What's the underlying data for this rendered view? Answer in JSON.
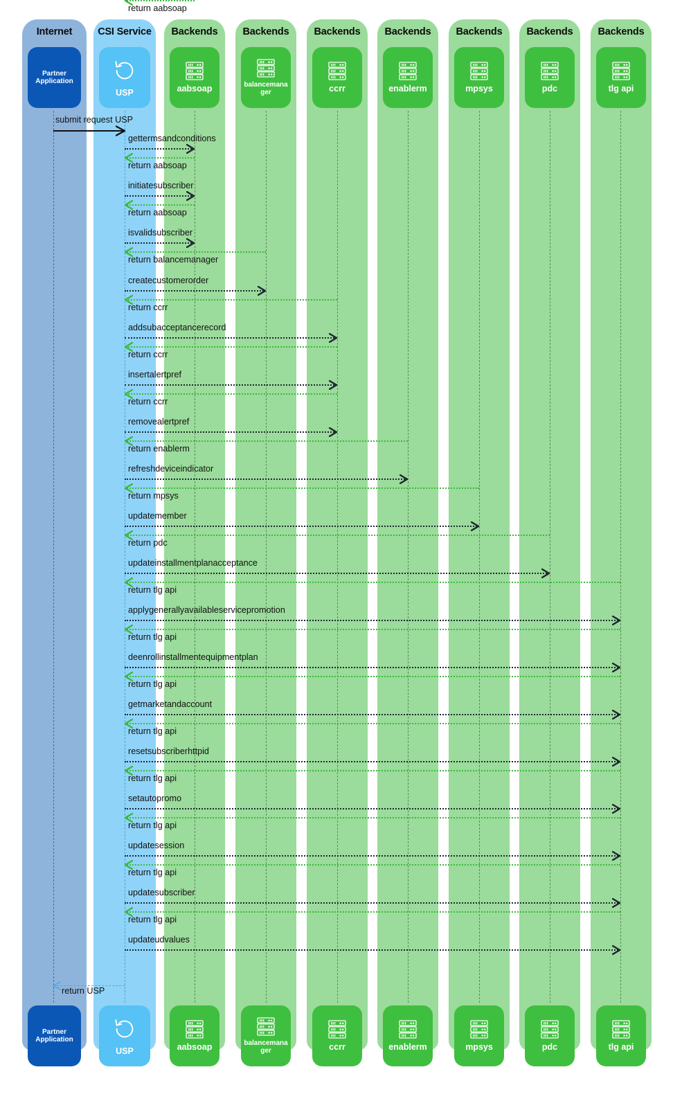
{
  "diagram": {
    "type": "sequence-diagram",
    "lanes": [
      {
        "id": "internet",
        "title": "Internet",
        "kind": "internet",
        "actor": "Partner Application",
        "icon": "none",
        "color": "#8FB4DC",
        "actor_color": "#0B57B5"
      },
      {
        "id": "csi",
        "title": "CSI Service",
        "kind": "csi",
        "actor": "USP",
        "icon": "refresh-icon",
        "color": "#90D3F8",
        "actor_color": "#56C2F5"
      },
      {
        "id": "aabsoap",
        "title": "Backends",
        "kind": "backend",
        "actor": "aabsoap",
        "icon": "server-icon",
        "color": "#9BDB9B",
        "actor_color": "#3FBF3F"
      },
      {
        "id": "balancemanager",
        "title": "Backends",
        "kind": "backend",
        "actor": "balancemanager",
        "icon": "server-icon",
        "color": "#9BDB9B",
        "actor_color": "#3FBF3F"
      },
      {
        "id": "ccrr",
        "title": "Backends",
        "kind": "backend",
        "actor": "ccrr",
        "icon": "server-icon",
        "color": "#9BDB9B",
        "actor_color": "#3FBF3F"
      },
      {
        "id": "enablerm",
        "title": "Backends",
        "kind": "backend",
        "actor": "enablerm",
        "icon": "server-icon",
        "color": "#9BDB9B",
        "actor_color": "#3FBF3F"
      },
      {
        "id": "mpsys",
        "title": "Backends",
        "kind": "backend",
        "actor": "mpsys",
        "icon": "server-icon",
        "color": "#9BDB9B",
        "actor_color": "#3FBF3F"
      },
      {
        "id": "pdc",
        "title": "Backends",
        "kind": "backend",
        "actor": "pdc",
        "icon": "server-icon",
        "color": "#9BDB9B",
        "actor_color": "#3FBF3F"
      },
      {
        "id": "tlgapi",
        "title": "Backends",
        "kind": "backend",
        "actor": "tlg api",
        "icon": "server-icon",
        "color": "#9BDB9B",
        "actor_color": "#3FBF3F"
      }
    ],
    "messages": [
      {
        "label": "submit request USP",
        "from": "internet",
        "to": "csi",
        "style": "solid-black",
        "dir": "right"
      },
      {
        "label": "gettermsandconditions",
        "from": "csi",
        "to": "aabsoap",
        "style": "dot-black",
        "dir": "right"
      },
      {
        "label": "return aabsoap",
        "from": "aabsoap",
        "to": "csi",
        "style": "dot-green",
        "dir": "left"
      },
      {
        "label": "initiatesubscriber",
        "from": "csi",
        "to": "aabsoap",
        "style": "dot-black",
        "dir": "right"
      },
      {
        "label": "return aabsoap",
        "from": "aabsoap",
        "to": "csi",
        "style": "dot-green",
        "dir": "left"
      },
      {
        "label": "isvalidsubscriber",
        "from": "csi",
        "to": "aabsoap",
        "style": "dot-black",
        "dir": "right"
      },
      {
        "label": "return aabsoap",
        "from": "aabsoap",
        "to": "csi",
        "style": "dot-green",
        "dir": "left"
      },
      {
        "label": "createcustomerorder",
        "from": "csi",
        "to": "balancemanager",
        "style": "dot-black",
        "dir": "right"
      },
      {
        "label": "return balancemanager",
        "from": "balancemanager",
        "to": "csi",
        "style": "dot-green",
        "dir": "left"
      },
      {
        "label": "addsubacceptancerecord",
        "from": "csi",
        "to": "ccrr",
        "style": "dot-black",
        "dir": "right"
      },
      {
        "label": "return ccrr",
        "from": "ccrr",
        "to": "csi",
        "style": "dot-green",
        "dir": "left"
      },
      {
        "label": "insertalertpref",
        "from": "csi",
        "to": "ccrr",
        "style": "dot-black",
        "dir": "right"
      },
      {
        "label": "return ccrr",
        "from": "ccrr",
        "to": "csi",
        "style": "dot-green",
        "dir": "left"
      },
      {
        "label": "removealertpref",
        "from": "csi",
        "to": "ccrr",
        "style": "dot-black",
        "dir": "right"
      },
      {
        "label": "return ccrr",
        "from": "ccrr",
        "to": "csi",
        "style": "dot-green",
        "dir": "left"
      },
      {
        "label": "refreshdeviceindicator",
        "from": "csi",
        "to": "enablerm",
        "style": "dot-black",
        "dir": "right"
      },
      {
        "label": "return enablerm",
        "from": "enablerm",
        "to": "csi",
        "style": "dot-green",
        "dir": "left"
      },
      {
        "label": "updatemember",
        "from": "csi",
        "to": "mpsys",
        "style": "dot-black",
        "dir": "right"
      },
      {
        "label": "return mpsys",
        "from": "mpsys",
        "to": "csi",
        "style": "dot-green",
        "dir": "left"
      },
      {
        "label": "updateinstallmentplanacceptance",
        "from": "csi",
        "to": "pdc",
        "style": "dot-black",
        "dir": "right"
      },
      {
        "label": "return pdc",
        "from": "pdc",
        "to": "csi",
        "style": "dot-green",
        "dir": "left"
      },
      {
        "label": "applygenerallyavailableservicepromotion",
        "from": "csi",
        "to": "tlgapi",
        "style": "dot-black",
        "dir": "right"
      },
      {
        "label": "return tlg api",
        "from": "tlgapi",
        "to": "csi",
        "style": "dot-green",
        "dir": "left"
      },
      {
        "label": "deenrollinstallmentequipmentplan",
        "from": "csi",
        "to": "tlgapi",
        "style": "dot-black",
        "dir": "right"
      },
      {
        "label": "return tlg api",
        "from": "tlgapi",
        "to": "csi",
        "style": "dot-green",
        "dir": "left"
      },
      {
        "label": "getmarketandaccount",
        "from": "csi",
        "to": "tlgapi",
        "style": "dot-black",
        "dir": "right"
      },
      {
        "label": "return tlg api",
        "from": "tlgapi",
        "to": "csi",
        "style": "dot-green",
        "dir": "left"
      },
      {
        "label": "resetsubscriberhttpid",
        "from": "csi",
        "to": "tlgapi",
        "style": "dot-black",
        "dir": "right"
      },
      {
        "label": "return tlg api",
        "from": "tlgapi",
        "to": "csi",
        "style": "dot-green",
        "dir": "left"
      },
      {
        "label": "setautopromo",
        "from": "csi",
        "to": "tlgapi",
        "style": "dot-black",
        "dir": "right"
      },
      {
        "label": "return tlg api",
        "from": "tlgapi",
        "to": "csi",
        "style": "dot-green",
        "dir": "left"
      },
      {
        "label": "updatesession",
        "from": "csi",
        "to": "tlgapi",
        "style": "dot-black",
        "dir": "right"
      },
      {
        "label": "return tlg api",
        "from": "tlgapi",
        "to": "csi",
        "style": "dot-green",
        "dir": "left"
      },
      {
        "label": "updatesubscriber",
        "from": "csi",
        "to": "tlgapi",
        "style": "dot-black",
        "dir": "right"
      },
      {
        "label": "return tlg api",
        "from": "tlgapi",
        "to": "csi",
        "style": "dot-green",
        "dir": "left"
      },
      {
        "label": "updateudvalues",
        "from": "csi",
        "to": "tlgapi",
        "style": "dot-black",
        "dir": "right"
      },
      {
        "label": "return tlg api",
        "from": "tlgapi",
        "to": "csi",
        "style": "dot-green",
        "dir": "left"
      },
      {
        "label": "return USP",
        "from": "csi",
        "to": "internet",
        "style": "dash-blue",
        "dir": "left"
      }
    ]
  }
}
